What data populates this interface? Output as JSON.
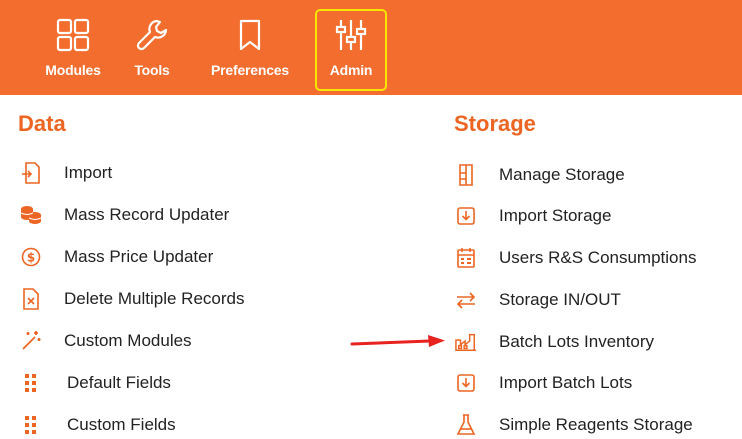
{
  "toolbar": {
    "items": [
      {
        "label": "Modules",
        "icon": "grid-icon"
      },
      {
        "label": "Tools",
        "icon": "wrench-icon"
      },
      {
        "label": "Preferences",
        "icon": "bookmark-icon"
      },
      {
        "label": "Admin",
        "icon": "sliders-icon",
        "active": true
      }
    ],
    "active_outline_color": "#f7e600",
    "background": "#f26d2e"
  },
  "data_section": {
    "title": "Data",
    "items": [
      {
        "label": "Import",
        "icon": "import-file-icon"
      },
      {
        "label": "Mass Record Updater",
        "icon": "database-stack-icon"
      },
      {
        "label": "Mass Price Updater",
        "icon": "dollar-circle-icon"
      },
      {
        "label": "Delete Multiple Records",
        "icon": "delete-file-icon"
      },
      {
        "label": "Custom Modules",
        "icon": "magic-wand-icon"
      },
      {
        "label": "Default Fields",
        "icon": "dots-grid-icon"
      },
      {
        "label": "Custom Fields",
        "icon": "dots-grid-icon"
      }
    ]
  },
  "storage_section": {
    "title": "Storage",
    "items": [
      {
        "label": "Manage Storage",
        "icon": "storage-icon"
      },
      {
        "label": "Import Storage",
        "icon": "import-box-icon"
      },
      {
        "label": "Users R&S Consumptions",
        "icon": "calendar-icon"
      },
      {
        "label": "Storage IN/OUT",
        "icon": "swap-arrows-icon"
      },
      {
        "label": "Batch Lots Inventory",
        "icon": "factory-icon"
      },
      {
        "label": "Import Batch Lots",
        "icon": "import-box-icon"
      },
      {
        "label": "Simple Reagents Storage",
        "icon": "flask-icon"
      }
    ]
  },
  "accent_color": "#ec6523",
  "annotation_arrow_color": "#e8231f"
}
